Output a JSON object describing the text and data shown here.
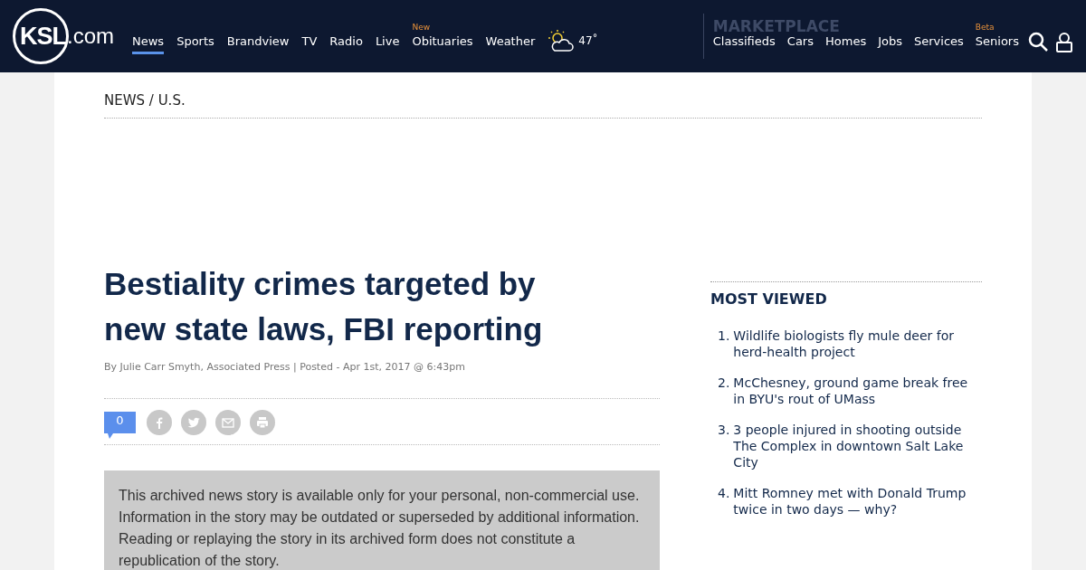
{
  "header": {
    "logo": {
      "main": "KSL",
      "suffix": ".com"
    },
    "nav": [
      {
        "label": "News",
        "selected": true
      },
      {
        "label": "Sports",
        "selected": false
      },
      {
        "label": "Brandview",
        "selected": false
      },
      {
        "label": "TV",
        "selected": false
      },
      {
        "label": "Radio",
        "selected": false
      },
      {
        "label": "Live",
        "selected": false
      },
      {
        "label": "Obituaries",
        "selected": false,
        "badge": "New"
      },
      {
        "label": "Weather",
        "selected": false
      }
    ],
    "weather": {
      "temperature": "47˚"
    },
    "marketplace": {
      "title": "MARKETPLACE",
      "items": [
        {
          "label": "Classifieds"
        },
        {
          "label": "Cars"
        },
        {
          "label": "Homes"
        },
        {
          "label": "Jobs"
        },
        {
          "label": "Services"
        },
        {
          "label": "Seniors",
          "badge": "Beta"
        }
      ]
    }
  },
  "breadcrumb": "NEWS / U.S.",
  "article": {
    "title": "Bestiality crimes targeted by new state laws, FBI reporting",
    "byline": "By Julie Carr Smyth, Associated Press | Posted - Apr 1st, 2017 @ 6:43pm",
    "comment_count": "0",
    "notice": "This archived news story is available only for your personal, non-commercial use. Information in the story may be outdated or superseded by additional information. Reading or replaying the story in its archived form does not constitute a republication of the story."
  },
  "most_viewed": {
    "title": "MOST VIEWED",
    "items": [
      {
        "number": "1.",
        "title": "Wildlife biologists fly mule deer for herd-health project"
      },
      {
        "number": "2.",
        "title": "McChesney, ground game break free in BYU's rout of UMass"
      },
      {
        "number": "3.",
        "title": "3 people injured in shooting outside The Complex in downtown Salt Lake City"
      },
      {
        "number": "4.",
        "title": "Mitt Romney met with Donald Trump twice in two days — why?"
      }
    ]
  }
}
